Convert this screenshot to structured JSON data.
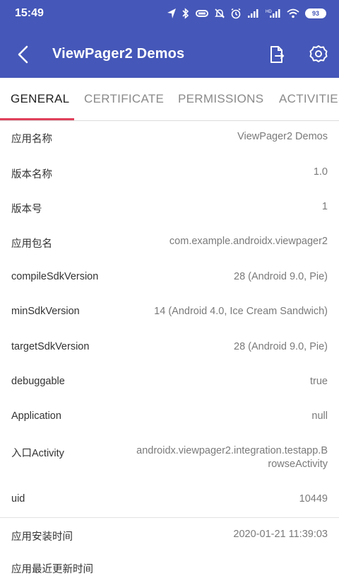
{
  "status_bar": {
    "time": "15:49",
    "battery": "93",
    "icons": [
      "location-icon",
      "bluetooth-icon",
      "vibrate-icon",
      "mute-icon",
      "alarm-icon",
      "signal-icon",
      "hd-signal-icon",
      "wifi-icon",
      "battery-icon"
    ]
  },
  "toolbar": {
    "title": "ViewPager2 Demos",
    "accent_color": "#4557b8"
  },
  "tabs": [
    {
      "label": "GENERAL",
      "active": true
    },
    {
      "label": "CERTIFICATE",
      "active": false
    },
    {
      "label": "PERMISSIONS",
      "active": false
    },
    {
      "label": "ACTIVITIES",
      "active": false
    }
  ],
  "indicator_color": "#e0405a",
  "rows": [
    {
      "label": "应用名称",
      "value": "ViewPager2 Demos"
    },
    {
      "label": "版本名称",
      "value": "1.0"
    },
    {
      "label": "版本号",
      "value": "1"
    },
    {
      "label": "应用包名",
      "value": "com.example.androidx.viewpager2"
    },
    {
      "label": "compileSdkVersion",
      "value": "28 (Android 9.0, Pie)"
    },
    {
      "label": "minSdkVersion",
      "value": "14 (Android 4.0, Ice Cream Sandwich)"
    },
    {
      "label": "targetSdkVersion",
      "value": "28 (Android 9.0, Pie)"
    },
    {
      "label": "debuggable",
      "value": "true"
    },
    {
      "label": "Application",
      "value": "null"
    },
    {
      "label": "入口Activity",
      "value_line1": "androidx.viewpager2.integration.testapp.B",
      "value_line2": "rowseActivity"
    },
    {
      "label": "uid",
      "value": "10449"
    },
    {
      "label": "应用安装时间",
      "value": "2020-01-21 11:39:03"
    },
    {
      "label": "应用最近更新时间"
    }
  ]
}
